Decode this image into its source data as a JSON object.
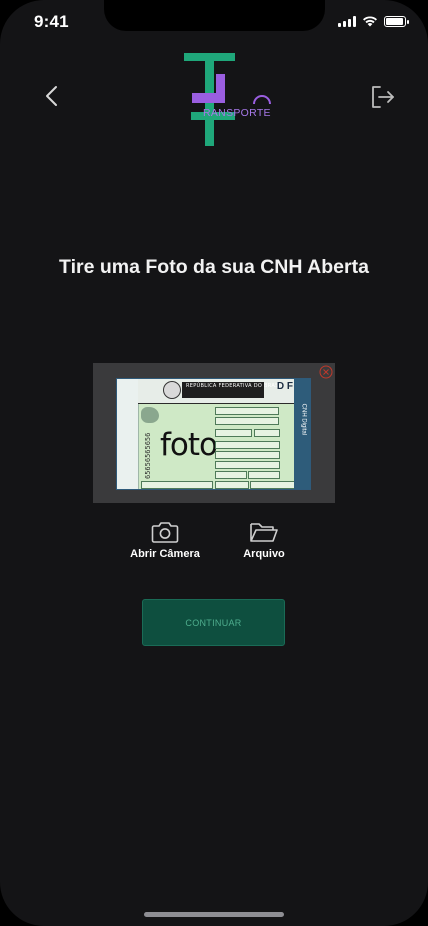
{
  "status_bar": {
    "time": "9:41"
  },
  "header": {
    "logo_text": "RANSPORTE"
  },
  "main": {
    "title": "Tire uma Foto da sua CNH Aberta",
    "document_preview": {
      "header_text": "REPÚBLICA FEDERATIVA DO BRASIL",
      "state": "D F",
      "photo_placeholder": "foto",
      "side_label": "CNH Digital",
      "number": "65656565656"
    },
    "actions": {
      "camera_label": "Abrir Câmera",
      "file_label": "Arquivo"
    },
    "continue_label": "CONTINUAR"
  },
  "colors": {
    "background": "#141416",
    "logo_green": "#1fa77a",
    "logo_purple": "#9a5ee0",
    "button_bg": "#0e4f3f",
    "button_text": "#4fae8e"
  }
}
